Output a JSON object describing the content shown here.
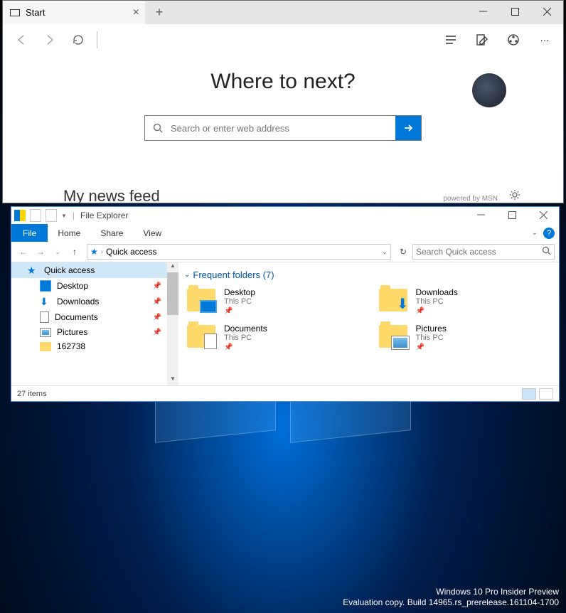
{
  "edge": {
    "tab_title": "Start",
    "heading": "Where to next?",
    "search_placeholder": "Search or enter web address",
    "news_feed_label": "My news feed",
    "powered_by": "powered by MSN"
  },
  "file_explorer": {
    "title": "File Explorer",
    "ribbon": {
      "file": "File",
      "home": "Home",
      "share": "Share",
      "view": "View"
    },
    "address": "Quick access",
    "search_placeholder": "Search Quick access",
    "nav": {
      "quick_access": "Quick access",
      "desktop": "Desktop",
      "downloads": "Downloads",
      "documents": "Documents",
      "pictures": "Pictures",
      "folder_162738": "162738"
    },
    "section_header": "Frequent folders (7)",
    "items": [
      {
        "name": "Desktop",
        "location": "This PC"
      },
      {
        "name": "Downloads",
        "location": "This PC"
      },
      {
        "name": "Documents",
        "location": "This PC"
      },
      {
        "name": "Pictures",
        "location": "This PC"
      }
    ],
    "status": "27 items"
  },
  "watermark": {
    "line1": "Windows 10 Pro Insider Preview",
    "line2": "Evaluation copy. Build 14965.rs_prerelease.161104-1700"
  }
}
